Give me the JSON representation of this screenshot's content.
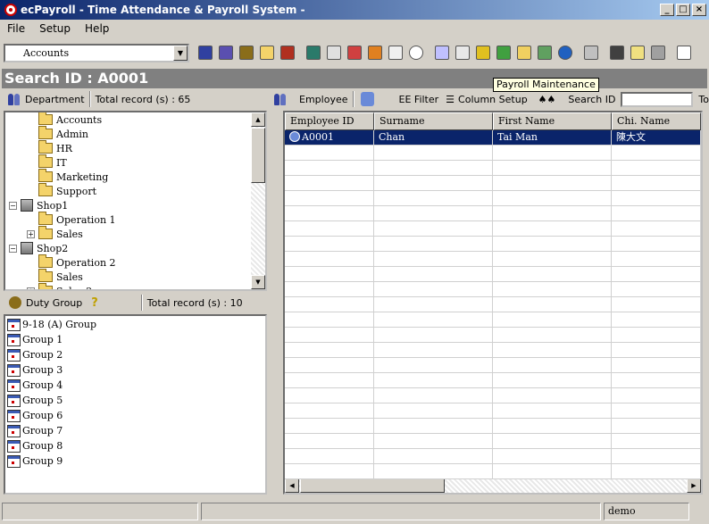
{
  "window": {
    "title": "ecPayroll - Time Attendance & Payroll System -"
  },
  "menu": [
    "File",
    "Setup",
    "Help"
  ],
  "toolbar": {
    "department_combo_value": "Accounts",
    "tooltip": "Payroll Maintenance"
  },
  "search": {
    "title": "Search ID : A0001"
  },
  "department_panel": {
    "label": "Department",
    "total": "Total record (s) : 65",
    "tree": [
      {
        "label": "Accounts",
        "kind": "folder",
        "level": 2
      },
      {
        "label": "Admin",
        "kind": "folder",
        "level": 2
      },
      {
        "label": "HR",
        "kind": "folder",
        "level": 2
      },
      {
        "label": "IT",
        "kind": "folder",
        "level": 2
      },
      {
        "label": "Marketing",
        "kind": "folder",
        "level": 2
      },
      {
        "label": "Support",
        "kind": "folder",
        "level": 2
      },
      {
        "label": "Shop1",
        "kind": "building",
        "level": 1,
        "expander": "−"
      },
      {
        "label": "Operation 1",
        "kind": "folder",
        "level": 2
      },
      {
        "label": "Sales",
        "kind": "folder",
        "level": 2,
        "expander": "+"
      },
      {
        "label": "Shop2",
        "kind": "building",
        "level": 1,
        "expander": "−"
      },
      {
        "label": "Operation 2",
        "kind": "folder",
        "level": 2
      },
      {
        "label": "Sales",
        "kind": "folder",
        "level": 2
      },
      {
        "label": "Sales 2",
        "kind": "folder",
        "level": 2,
        "expander": "+"
      }
    ]
  },
  "duty_group_panel": {
    "label": "Duty Group",
    "total": "Total record (s) : 10",
    "groups": [
      "9-18 (A) Group",
      "Group 1",
      "Group 2",
      "Group 3",
      "Group 4",
      "Group 5",
      "Group 6",
      "Group 7",
      "Group 8",
      "Group 9"
    ]
  },
  "employee_panel": {
    "label": "Employee",
    "ee_filter": "EE Filter",
    "column_setup": "Column Setup",
    "search_id_label": "Search ID",
    "search_id_value": "",
    "truncated_label": "To"
  },
  "grid": {
    "columns": [
      "Employee ID",
      "Surname",
      "First Name",
      "Chi. Name"
    ],
    "rows": [
      {
        "id": "A0001",
        "surname": "Chan",
        "first": "Tai Man",
        "chi": "陳大文"
      }
    ]
  },
  "status": {
    "user": "demo"
  }
}
